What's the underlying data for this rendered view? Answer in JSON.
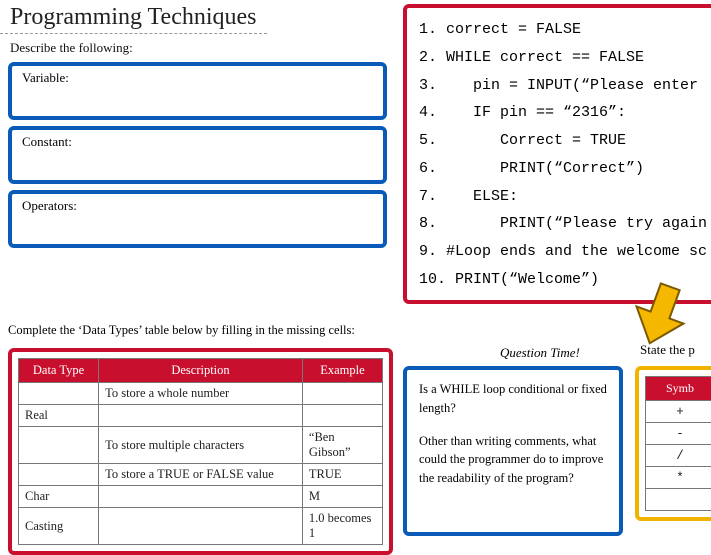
{
  "title": "Programming Techniques",
  "describe_prompt": "Describe the following:",
  "describe_labels": {
    "variable": "Variable:",
    "constant": "Constant:",
    "operators": "Operators:"
  },
  "code_lines": [
    "1. correct = FALSE",
    "2. WHILE correct == FALSE",
    "3.    pin = INPUT(“Please enter ",
    "4.    IF pin == “2316”:",
    "5.       Correct = TRUE",
    "6.       PRINT(“Correct”)",
    "7.    ELSE:",
    "8.       PRINT(“Please try again",
    "9. #Loop ends and the welcome sc",
    "10. PRINT(“Welcome”)"
  ],
  "datatypes_prompt": "Complete the ‘Data Types’ table below by filling in the missing cells:",
  "datatypes_headers": [
    "Data Type",
    "Description",
    "Example"
  ],
  "datatypes_rows": [
    [
      "",
      "To store a whole number",
      ""
    ],
    [
      "Real",
      "",
      ""
    ],
    [
      "",
      "To store multiple characters",
      "“Ben Gibson”"
    ],
    [
      "",
      "To store a TRUE or FALSE value",
      "TRUE"
    ],
    [
      "Char",
      "",
      "M"
    ],
    [
      "Casting",
      "",
      "1.0 becomes 1"
    ]
  ],
  "question_time_label": "Question Time!",
  "state_label": "State the p",
  "questions": {
    "q1": "Is a WHILE loop conditional or fixed length?",
    "q2": "Other than writing comments, what could the programmer do to improve the readability of the program?"
  },
  "symbol_header": "Symb",
  "symbol_rows": [
    "+",
    "-",
    "/",
    "*",
    ""
  ]
}
